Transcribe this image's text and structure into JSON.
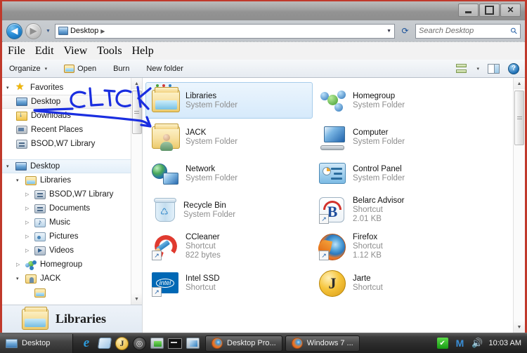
{
  "window": {
    "title": "",
    "controls": {
      "minimize": "—",
      "maximize": "❐",
      "close": "✕"
    }
  },
  "address_bar": {
    "back_label": "◀",
    "forward_label": "▶",
    "history_caret": "▼",
    "breadcrumb": {
      "root": "Desktop",
      "separator": "▶",
      "dropdown_caret": "▼"
    },
    "refresh_label": "⟳",
    "search": {
      "placeholder": "Search Desktop",
      "icon": "⚲"
    }
  },
  "menubar": {
    "items": [
      "File",
      "Edit",
      "View",
      "Tools",
      "Help"
    ]
  },
  "toolbar": {
    "organize": "Organize",
    "organize_caret": "▾",
    "open": "Open",
    "burn": "Burn",
    "new_folder": "New folder",
    "view_caret": "▾",
    "help_label": "?"
  },
  "annotation": {
    "text": "CLICK",
    "color": "#1a2ee0"
  },
  "nav_pane": {
    "items": [
      {
        "label": "Favorites",
        "icon": "star-icon",
        "indent": 0,
        "tri": "▾",
        "state": "normal"
      },
      {
        "label": "Desktop",
        "icon": "monitor-icon",
        "indent": 1,
        "tri": "",
        "state": "selected"
      },
      {
        "label": "Downloads",
        "icon": "downloads-icon",
        "indent": 1,
        "tri": "",
        "state": "normal"
      },
      {
        "label": "Recent Places",
        "icon": "recent-places-icon",
        "indent": 1,
        "tri": "",
        "state": "normal"
      },
      {
        "label": "BSOD,W7 Library",
        "icon": "library-stack-icon",
        "indent": 1,
        "tri": "",
        "state": "normal"
      },
      {
        "label": "Desktop",
        "icon": "monitor-icon",
        "indent": 0,
        "tri": "▾",
        "state": "header"
      },
      {
        "label": "Libraries",
        "icon": "libraries-icon",
        "indent": 1,
        "tri": "▾",
        "state": "normal"
      },
      {
        "label": "BSOD,W7 Library",
        "icon": "library-stack-icon",
        "indent": 2,
        "tri": "▷",
        "state": "normal"
      },
      {
        "label": "Documents",
        "icon": "documents-icon",
        "indent": 2,
        "tri": "▷",
        "state": "normal"
      },
      {
        "label": "Music",
        "icon": "music-icon",
        "indent": 2,
        "tri": "▷",
        "state": "normal"
      },
      {
        "label": "Pictures",
        "icon": "pictures-icon",
        "indent": 2,
        "tri": "▷",
        "state": "normal"
      },
      {
        "label": "Videos",
        "icon": "videos-icon",
        "indent": 2,
        "tri": "▷",
        "state": "normal"
      },
      {
        "label": "Homegroup",
        "icon": "homegroup-icon",
        "indent": 1,
        "tri": "▷",
        "state": "normal"
      },
      {
        "label": "JACK",
        "icon": "user-folder-icon",
        "indent": 1,
        "tri": "▾",
        "state": "normal"
      }
    ],
    "scroll": {
      "up": "▲",
      "down": "▼"
    }
  },
  "file_list": {
    "items": [
      {
        "name": "Libraries",
        "type": "System Folder",
        "size": "",
        "icon": "libraries-folder-icon",
        "selected": true,
        "shortcut": false
      },
      {
        "name": "JACK",
        "type": "System Folder",
        "size": "",
        "icon": "user-folder-icon",
        "selected": false,
        "shortcut": false
      },
      {
        "name": "Network",
        "type": "System Folder",
        "size": "",
        "icon": "network-icon",
        "selected": false,
        "shortcut": false
      },
      {
        "name": "Recycle Bin",
        "type": "System Folder",
        "size": "",
        "icon": "recycle-bin-icon",
        "selected": false,
        "shortcut": false
      },
      {
        "name": "CCleaner",
        "type": "Shortcut",
        "size": "822 bytes",
        "icon": "ccleaner-icon",
        "selected": false,
        "shortcut": true
      },
      {
        "name": "Intel SSD",
        "type": "Shortcut",
        "size": "",
        "icon": "intel-ssd-icon",
        "selected": false,
        "shortcut": true
      },
      {
        "name": "Homegroup",
        "type": "System Folder",
        "size": "",
        "icon": "homegroup-icon",
        "selected": false,
        "shortcut": false
      },
      {
        "name": "Computer",
        "type": "System Folder",
        "size": "",
        "icon": "computer-icon",
        "selected": false,
        "shortcut": false
      },
      {
        "name": "Control Panel",
        "type": "System Folder",
        "size": "",
        "icon": "control-panel-icon",
        "selected": false,
        "shortcut": false
      },
      {
        "name": "Belarc Advisor",
        "type": "Shortcut",
        "size": "2.01 KB",
        "icon": "belarc-advisor-icon",
        "selected": false,
        "shortcut": true
      },
      {
        "name": "Firefox",
        "type": "Shortcut",
        "size": "1.12 KB",
        "icon": "firefox-icon",
        "selected": false,
        "shortcut": true
      },
      {
        "name": "Jarte",
        "type": "Shortcut",
        "size": "",
        "icon": "jarte-icon",
        "selected": false,
        "shortcut": false
      }
    ],
    "shortcut_badge": "↗"
  },
  "details_pane": {
    "title": "Libraries",
    "icon": "libraries-folder-icon"
  },
  "taskbar": {
    "desktop_band": "Desktop",
    "quick_launch": [
      "ie-icon",
      "notepad-icon",
      "jarte-icon",
      "norton-icon",
      "green-app-icon",
      "command-prompt-icon",
      "blue-window-icon"
    ],
    "tasks": [
      {
        "label": "Desktop Pro...",
        "icon": "firefox-icon"
      },
      {
        "label": "Windows 7 ...",
        "icon": "firefox-icon"
      }
    ],
    "tray": [
      "green-check-icon",
      "messenger-icon",
      "volume-icon"
    ],
    "clock": "10:03 AM"
  },
  "colors": {
    "accent": "#2a78bd",
    "selection": "#d6eafb",
    "annotation": "#1a2ee0",
    "frame_red": "#c0392b"
  }
}
